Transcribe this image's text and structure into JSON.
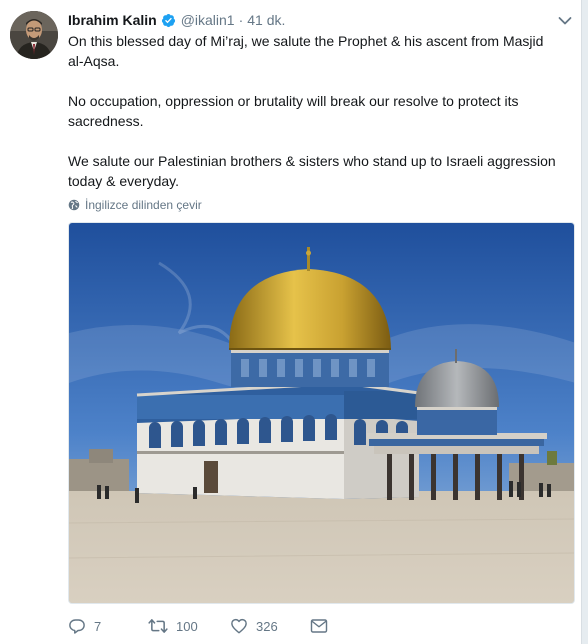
{
  "tweet": {
    "author_name": "Ibrahim Kalin",
    "handle": "@ikalin1",
    "separator": "·",
    "time": "41 dk.",
    "paragraphs": [
      "On this blessed day of Mi’raj, we salute the Prophet & his ascent from Masjid al-Aqsa.",
      "No occupation, oppression or brutality will break our resolve to protect its sacredness.",
      "We salute our Palestinian brothers & sisters who stand up to Israeli aggression today & everyday."
    ],
    "translate_label": "İngilizce dilinden çevir"
  },
  "actions": {
    "replies": "7",
    "retweets": "100",
    "likes": "326"
  },
  "icons": {
    "verified": "verified-badge-icon",
    "caret": "chevron-down-icon",
    "globe": "globe-icon",
    "reply": "reply-icon",
    "retweet": "retweet-icon",
    "like": "heart-icon",
    "dm": "envelope-icon"
  },
  "colors": {
    "verified": "#1da1f2",
    "secondary_text": "#657786",
    "primary_text": "#14171a"
  }
}
